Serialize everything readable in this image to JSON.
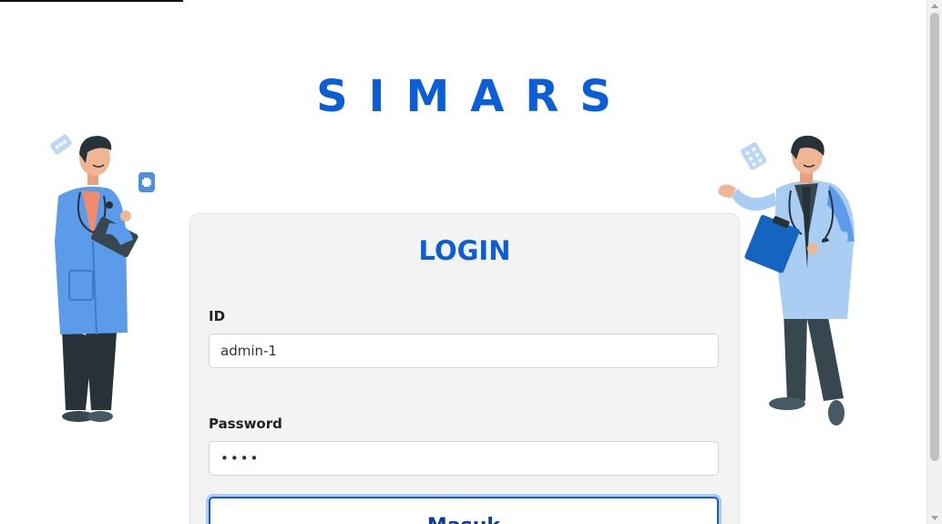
{
  "app": {
    "brand": "SIMARS"
  },
  "login": {
    "title": "LOGIN",
    "id_label": "ID",
    "id_value": "admin-1",
    "password_label": "Password",
    "password_value": "••••",
    "submit_label": "Masuk"
  },
  "colors": {
    "brand_blue": "#0b5ed7",
    "card_bg": "#f3f3f3"
  },
  "icons": {
    "left_illustration": "doctor-with-clipboard-illustration",
    "right_illustration": "doctor-presenting-illustration"
  }
}
